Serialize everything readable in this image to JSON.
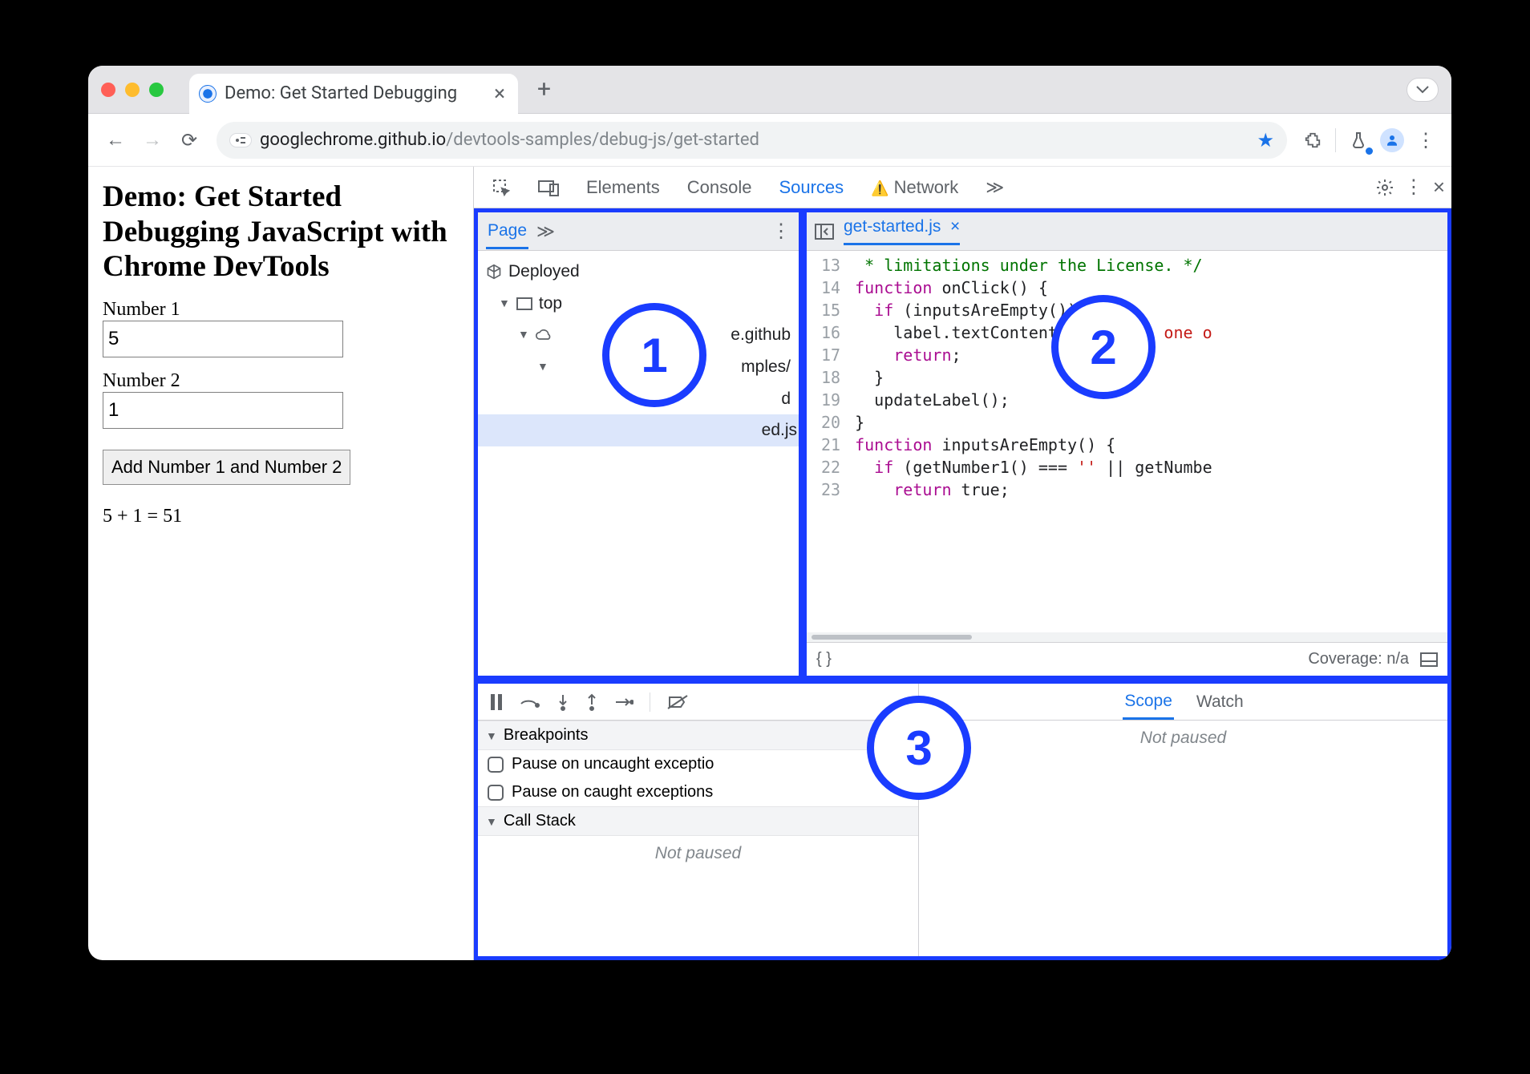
{
  "browser": {
    "tab_title": "Demo: Get Started Debugging",
    "url_host": "googlechrome.github.io",
    "url_path": "/devtools-samples/debug-js/get-started"
  },
  "page": {
    "heading": "Demo: Get Started Debugging JavaScript with Chrome DevTools",
    "label1": "Number 1",
    "input1": "5",
    "label2": "Number 2",
    "input2": "1",
    "button": "Add Number 1 and Number 2",
    "result": "5 + 1 = 51"
  },
  "devtools": {
    "tabs": {
      "elements": "Elements",
      "console": "Console",
      "sources": "Sources",
      "network": "Network"
    },
    "nav": {
      "tab": "Page",
      "deployed": "Deployed",
      "top": "top",
      "origin": "e.github",
      "folder": "mples/",
      "file_partial": "d",
      "selected": "ed.js"
    },
    "editor": {
      "filename": "get-started.js",
      "coverage": "Coverage: n/a",
      "lines": {
        "l13": " * limitations under the License. */",
        "l14a": "function",
        "l14b": " onClick() {",
        "l15a": "  if",
        "l15b": " (inputsAreEmpty()) {",
        "l16a": "    label.textContent = ",
        "l16b": "'Error: one o",
        "l17a": "    return",
        "l17b": ";",
        "l18": "  }",
        "l19": "  updateLabel();",
        "l20": "}",
        "l21a": "function",
        "l21b": " inputsAreEmpty() {",
        "l22a": "  if",
        "l22b": " (getNumber1() === ",
        "l22c": "''",
        "l22d": " || getNumbe",
        "l23a": "    return",
        "l23b": " true;"
      },
      "linenums": [
        "13",
        "14",
        "15",
        "16",
        "17",
        "18",
        "19",
        "20",
        "21",
        "22",
        "23"
      ]
    },
    "debug": {
      "breakpoints": "Breakpoints",
      "pause_uncaught": "Pause on uncaught exceptio",
      "pause_caught": "Pause on caught exceptions",
      "callstack": "Call Stack",
      "not_paused": "Not paused",
      "scope": "Scope",
      "watch": "Watch"
    }
  },
  "annotations": {
    "c1": "1",
    "c2": "2",
    "c3": "3"
  }
}
